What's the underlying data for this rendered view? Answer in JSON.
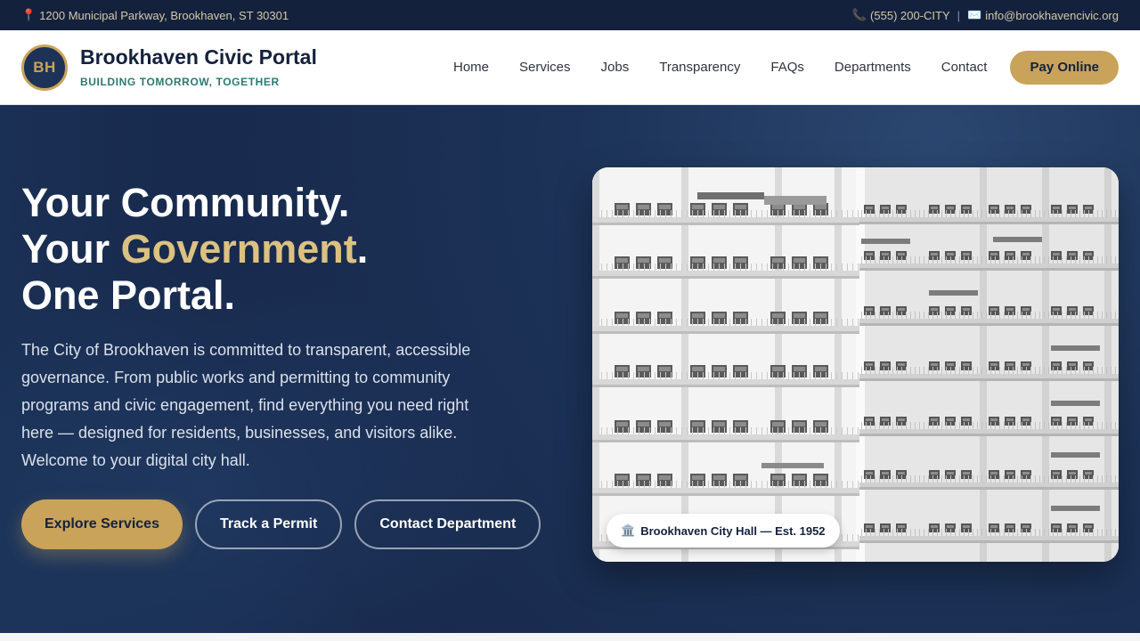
{
  "topbar": {
    "address": "1200 Municipal Parkway, Brookhaven, ST 30301",
    "phone": "(555) 200-CITY",
    "separator": "|",
    "email": "info@brookhavencivic.org",
    "icons": [
      "map-pin-icon",
      "phone-icon",
      "mail-icon"
    ]
  },
  "header": {
    "logo_initials": "BH",
    "site_name": "Brookhaven Civic Portal",
    "tagline": "BUILDING TOMORROW, TOGETHER",
    "nav": [
      {
        "label": "Home"
      },
      {
        "label": "Services"
      },
      {
        "label": "Jobs"
      },
      {
        "label": "Transparency"
      },
      {
        "label": "FAQs"
      },
      {
        "label": "Departments"
      },
      {
        "label": "Contact"
      }
    ],
    "cta_label": "Pay Online"
  },
  "hero": {
    "line1": "Your Community.",
    "line2_prefix": "Your ",
    "line2_highlight": "Government",
    "line2_suffix": ".",
    "line3": "One Portal.",
    "lede": "The City of Brookhaven is committed to transparent, accessible governance. From public works and permitting to community programs and civic engagement, find everything you need right here — designed for residents, businesses, and visitors alike. Welcome to your digital city hall.",
    "buttons": {
      "primary": "Explore Services",
      "secondary": "Track a Permit",
      "tertiary": "Contact Department"
    },
    "photo_caption": "Brookhaven City Hall — Est. 1952",
    "caption_icon": "government-building-icon"
  },
  "colors": {
    "navy": "#14213d",
    "hero_blue": "#1c3257",
    "gold": "#c9a35a",
    "highlight_gold": "#dcc181",
    "teal": "#2b7a70"
  }
}
